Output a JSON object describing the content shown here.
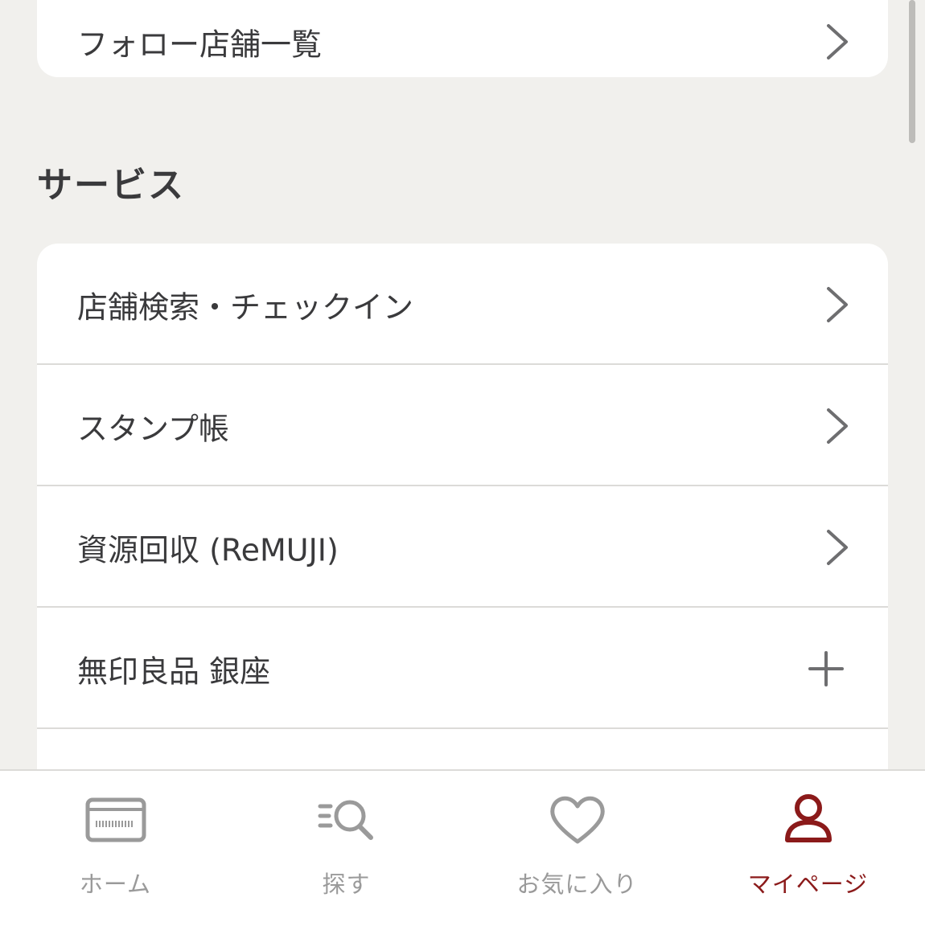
{
  "top_card": {
    "follow_stores_label": "フォロー店舗一覧"
  },
  "services": {
    "section_title": "サービス",
    "items": [
      {
        "label": "店舗検索・チェックイン",
        "icon": "chevron-right-icon"
      },
      {
        "label": "スタンプ帳",
        "icon": "chevron-right-icon"
      },
      {
        "label": "資源回収 (ReMUJI)",
        "icon": "chevron-right-icon"
      },
      {
        "label": "無印良品 銀座",
        "icon": "plus-icon"
      }
    ]
  },
  "tab_bar": {
    "tabs": [
      {
        "label": "ホーム",
        "icon": "card-icon",
        "active": false
      },
      {
        "label": "探す",
        "icon": "search-list-icon",
        "active": false
      },
      {
        "label": "お気に入り",
        "icon": "heart-icon",
        "active": false
      },
      {
        "label": "マイページ",
        "icon": "person-icon",
        "active": true
      }
    ]
  },
  "colors": {
    "background": "#f1f0ed",
    "card": "#ffffff",
    "text": "#3a3a3c",
    "tab_inactive": "#9a9a9a",
    "tab_active": "#8b1a1a",
    "divider": "#dcdbd8"
  }
}
